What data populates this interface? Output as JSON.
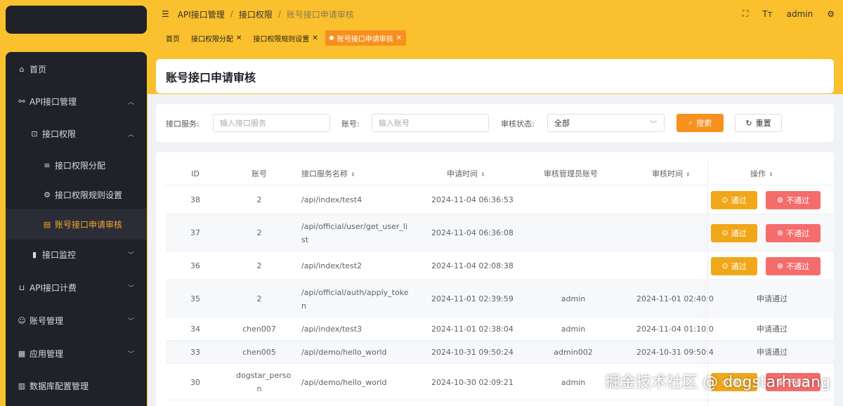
{
  "sidebar": {
    "items": [
      {
        "icon": "home-icon",
        "glyph": "⌂",
        "label": "首页"
      },
      {
        "icon": "link-icon",
        "glyph": "🔗",
        "label": "API接口管理",
        "chevron": "up"
      },
      {
        "icon": "lock-icon",
        "glyph": "🔒",
        "label": "接口权限",
        "chevron": "up"
      },
      {
        "icon": "sliders-icon",
        "glyph": "⚙",
        "label": "接口权限分配"
      },
      {
        "icon": "gear-icon",
        "glyph": "⚙",
        "label": "接口权限规则设置"
      },
      {
        "icon": "clipboard-icon",
        "glyph": "▤",
        "label": "账号接口申请审核",
        "active": true
      },
      {
        "icon": "chart-icon",
        "glyph": "▮",
        "label": "接口监控",
        "chevron": "down"
      },
      {
        "icon": "cart-icon",
        "glyph": "🛒",
        "label": "API接口计费",
        "chevron": "down"
      },
      {
        "icon": "user-icon",
        "glyph": "☺",
        "label": "账号管理",
        "chevron": "down"
      },
      {
        "icon": "grid-icon",
        "glyph": "▦",
        "label": "应用管理",
        "chevron": "down"
      },
      {
        "icon": "database-icon",
        "glyph": "▥",
        "label": "数据库配置管理"
      }
    ]
  },
  "breadcrumb": {
    "items": [
      "API接口管理",
      "接口权限",
      "账号接口申请审核"
    ],
    "separator": "/"
  },
  "topbar": {
    "user": "admin",
    "font_size_glyph": "Tт"
  },
  "tabs": [
    {
      "label": "首页",
      "closable": false
    },
    {
      "label": "接口权限分配",
      "closable": true
    },
    {
      "label": "接口权限规则设置",
      "closable": true
    },
    {
      "label": "账号接口申请审核",
      "closable": true,
      "active": true
    }
  ],
  "page": {
    "title": "账号接口申请审核"
  },
  "search": {
    "service_label": "接口服务:",
    "service_placeholder": "输入接口服务",
    "account_label": "账号:",
    "account_placeholder": "输入账号",
    "status_label": "审核状态:",
    "status_value": "全部",
    "search_button": "搜索",
    "reset_button": "重置"
  },
  "table": {
    "headers": {
      "id": "ID",
      "account": "账号",
      "service": "接口服务名称",
      "apply_time": "申请时间",
      "admin": "审核管理员账号",
      "review_time": "审核时间",
      "action": "操作"
    },
    "pass_button": "通过",
    "reject_button": "不通过",
    "rows": [
      {
        "id": "38",
        "account": "2",
        "service": "/api/index/test4",
        "apply_time": "2024-11-04 06:36:53",
        "admin": "",
        "review_time": "",
        "status": ""
      },
      {
        "id": "37",
        "account": "2",
        "service": "/api/official/user/get_user_li\nst",
        "apply_time": "2024-11-04 06:36:08",
        "admin": "",
        "review_time": "",
        "status": ""
      },
      {
        "id": "36",
        "account": "2",
        "service": "/api/index/test2",
        "apply_time": "2024-11-04 02:08:38",
        "admin": "",
        "review_time": "",
        "status": ""
      },
      {
        "id": "35",
        "account": "2",
        "service": "/api/official/auth/apply_toke\nn",
        "apply_time": "2024-11-01 02:39:59",
        "admin": "admin",
        "review_time": "2024-11-01 02:40:0",
        "status": "申请通过"
      },
      {
        "id": "34",
        "account": "chen007",
        "service": "/api/index/test3",
        "apply_time": "2024-11-01 02:38:04",
        "admin": "admin",
        "review_time": "2024-11-04 01:10:0",
        "status": "申请通过"
      },
      {
        "id": "33",
        "account": "chen005",
        "service": "/api/demo/hello_world",
        "apply_time": "2024-10-31 09:50:24",
        "admin": "admin002",
        "review_time": "2024-10-31 09:50:4",
        "status": "申请通过"
      },
      {
        "id": "30",
        "account": "dogstar_perso\nn",
        "service": "/api/demo/hello_world",
        "apply_time": "2024-10-30 02:09:21",
        "admin": "admin",
        "review_time": "",
        "status": ""
      }
    ]
  },
  "watermark": "掘金技术社区 @ dogstarhuang"
}
